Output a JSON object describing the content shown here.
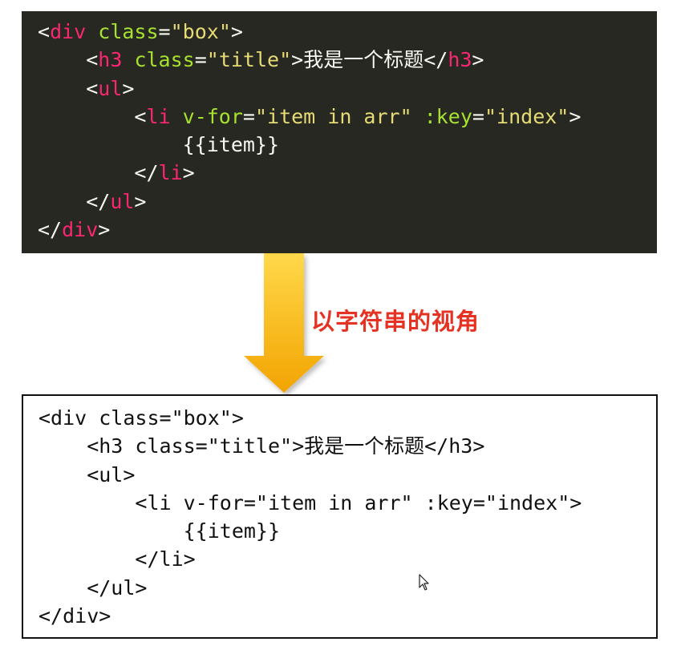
{
  "dark_code": {
    "lines": [
      [
        [
          "punc",
          "<"
        ],
        [
          "tag",
          "div"
        ],
        [
          "punc",
          " "
        ],
        [
          "attr",
          "class"
        ],
        [
          "punc",
          "="
        ],
        [
          "str",
          "\"box\""
        ],
        [
          "punc",
          ">"
        ]
      ],
      [
        [
          "punc",
          "    <"
        ],
        [
          "tag",
          "h3"
        ],
        [
          "punc",
          " "
        ],
        [
          "attr",
          "class"
        ],
        [
          "punc",
          "="
        ],
        [
          "str",
          "\"title\""
        ],
        [
          "punc",
          ">"
        ],
        [
          "txt",
          "我是一个标题"
        ],
        [
          "punc",
          "</"
        ],
        [
          "tag",
          "h3"
        ],
        [
          "punc",
          ">"
        ]
      ],
      [
        [
          "punc",
          "    <"
        ],
        [
          "tag",
          "ul"
        ],
        [
          "punc",
          ">"
        ]
      ],
      [
        [
          "punc",
          "        <"
        ],
        [
          "tag",
          "li"
        ],
        [
          "punc",
          " "
        ],
        [
          "attr",
          "v-for"
        ],
        [
          "punc",
          "="
        ],
        [
          "str",
          "\"item in arr\""
        ],
        [
          "punc",
          " "
        ],
        [
          "attr",
          ":key"
        ],
        [
          "punc",
          "="
        ],
        [
          "str",
          "\"index\""
        ],
        [
          "punc",
          ">"
        ]
      ],
      [
        [
          "txt",
          "            {{item}}"
        ]
      ],
      [
        [
          "punc",
          "        </"
        ],
        [
          "tag",
          "li"
        ],
        [
          "punc",
          ">"
        ]
      ],
      [
        [
          "punc",
          "    </"
        ],
        [
          "tag",
          "ul"
        ],
        [
          "punc",
          ">"
        ]
      ],
      [
        [
          "punc",
          "</"
        ],
        [
          "tag",
          "div"
        ],
        [
          "punc",
          ">"
        ]
      ]
    ]
  },
  "arrow_label": "以字符串的视角",
  "plain_code": {
    "lines": [
      "<div class=\"box\">",
      "    <h3 class=\"title\">我是一个标题</h3>",
      "    <ul>",
      "        <li v-for=\"item in arr\" :key=\"index\">",
      "            {{item}}",
      "        </li>",
      "    </ul>",
      "</div>"
    ]
  },
  "colors": {
    "dark_bg": "#272822",
    "tag": "#f92672",
    "attr": "#a6e22e",
    "string": "#e6db74",
    "arrow_top": "#ffd23a",
    "arrow_bottom": "#f0a800",
    "label": "#e53222"
  }
}
